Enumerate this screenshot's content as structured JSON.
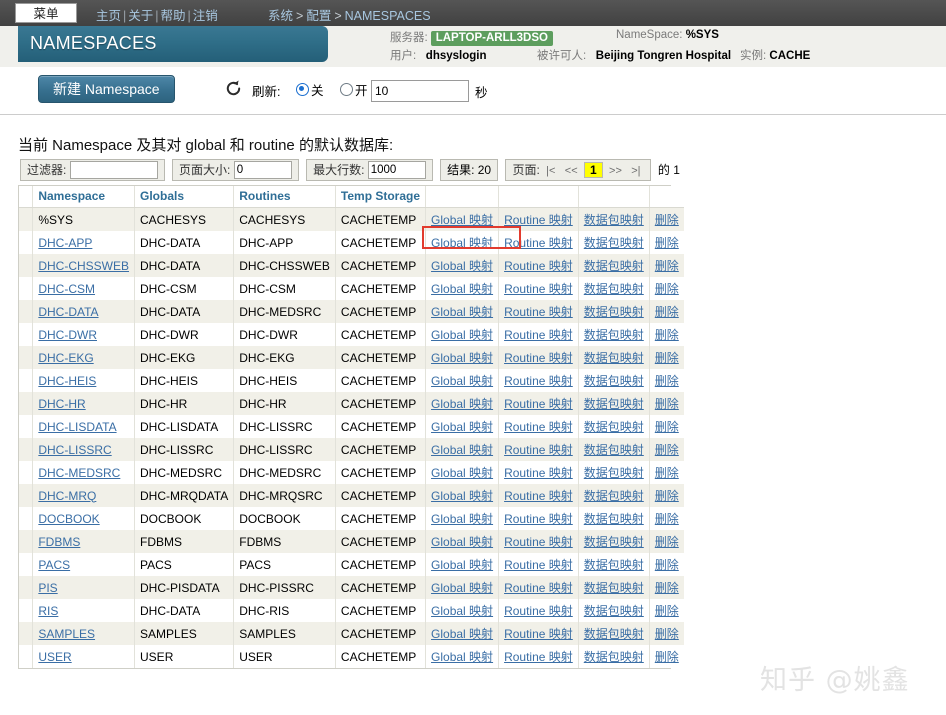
{
  "topbar": {
    "menu_label": "菜单",
    "nav_links": [
      "主页",
      "关于",
      "帮助",
      "注销"
    ],
    "breadcrumb": [
      "系统",
      "配置",
      "NAMESPACES"
    ],
    "breadcrumb_arrow": ">"
  },
  "header": {
    "page_title": "NAMESPACES",
    "server_label": "服务器:",
    "server_value": "LAPTOP-ARLL3DSO",
    "namespace_label": "NameSpace:",
    "namespace_value": "%SYS",
    "user_label": "用户:",
    "user_value": "dhsyslogin",
    "licensee_label": "被许可人:",
    "licensee_value": "Beijing Tongren Hospital",
    "instance_label": "实例:",
    "instance_value": "CACHE"
  },
  "toolbar": {
    "new_namespace_label": "新建 Namespace",
    "refresh_icon": "refresh-circular-arrow-icon",
    "refresh_label": "刷新:",
    "radio_off_label": "关",
    "radio_on_label": "开",
    "radio_selected": "关",
    "seconds_value": "10",
    "seconds_placeholder": "",
    "seconds_label": "秒"
  },
  "content": {
    "heading": "当前 Namespace 及其对 global 和 routine 的默认数据库:"
  },
  "filterbar": {
    "filter_label": "过滤器:",
    "filter_value": "",
    "filter_placeholder": "",
    "page_size_label": "页面大小:",
    "page_size_value": "0",
    "max_rows_label": "最大行数:",
    "max_rows_value": "1000",
    "results_label": "结果: 20",
    "page_label": "页面:",
    "first_icon": "|<",
    "prev_icon": "<<",
    "current_page": "1",
    "next_icon": ">>",
    "last_icon": ">|",
    "of_label": "的",
    "total_pages": "1"
  },
  "table": {
    "columns": [
      "",
      "Namespace",
      "Globals",
      "Routines",
      "Temp Storage",
      "",
      "",
      "",
      ""
    ],
    "actions": {
      "global_mapping": "Global 映射",
      "routine_mapping": "Routine 映射",
      "package_mapping": "数据包映射",
      "delete": "删除"
    },
    "rows": [
      {
        "namespace": "%SYS",
        "is_link": false,
        "globals": "CACHESYS",
        "routines": "CACHESYS",
        "temp": "CACHETEMP"
      },
      {
        "namespace": "DHC-APP",
        "is_link": true,
        "globals": "DHC-DATA",
        "routines": "DHC-APP",
        "temp": "CACHETEMP"
      },
      {
        "namespace": "DHC-CHSSWEB",
        "is_link": true,
        "globals": "DHC-DATA",
        "routines": "DHC-CHSSWEB",
        "temp": "CACHETEMP"
      },
      {
        "namespace": "DHC-CSM",
        "is_link": true,
        "globals": "DHC-CSM",
        "routines": "DHC-CSM",
        "temp": "CACHETEMP"
      },
      {
        "namespace": "DHC-DATA",
        "is_link": true,
        "globals": "DHC-DATA",
        "routines": "DHC-MEDSRC",
        "temp": "CACHETEMP"
      },
      {
        "namespace": "DHC-DWR",
        "is_link": true,
        "globals": "DHC-DWR",
        "routines": "DHC-DWR",
        "temp": "CACHETEMP"
      },
      {
        "namespace": "DHC-EKG",
        "is_link": true,
        "globals": "DHC-EKG",
        "routines": "DHC-EKG",
        "temp": "CACHETEMP"
      },
      {
        "namespace": "DHC-HEIS",
        "is_link": true,
        "globals": "DHC-HEIS",
        "routines": "DHC-HEIS",
        "temp": "CACHETEMP"
      },
      {
        "namespace": "DHC-HR",
        "is_link": true,
        "globals": "DHC-HR",
        "routines": "DHC-HR",
        "temp": "CACHETEMP"
      },
      {
        "namespace": "DHC-LISDATA",
        "is_link": true,
        "globals": "DHC-LISDATA",
        "routines": "DHC-LISSRC",
        "temp": "CACHETEMP"
      },
      {
        "namespace": "DHC-LISSRC",
        "is_link": true,
        "globals": "DHC-LISSRC",
        "routines": "DHC-LISSRC",
        "temp": "CACHETEMP"
      },
      {
        "namespace": "DHC-MEDSRC",
        "is_link": true,
        "globals": "DHC-MEDSRC",
        "routines": "DHC-MEDSRC",
        "temp": "CACHETEMP"
      },
      {
        "namespace": "DHC-MRQ",
        "is_link": true,
        "globals": "DHC-MRQDATA",
        "routines": "DHC-MRQSRC",
        "temp": "CACHETEMP"
      },
      {
        "namespace": "DOCBOOK",
        "is_link": true,
        "globals": "DOCBOOK",
        "routines": "DOCBOOK",
        "temp": "CACHETEMP"
      },
      {
        "namespace": "FDBMS",
        "is_link": true,
        "globals": "FDBMS",
        "routines": "FDBMS",
        "temp": "CACHETEMP"
      },
      {
        "namespace": "PACS",
        "is_link": true,
        "globals": "PACS",
        "routines": "PACS",
        "temp": "CACHETEMP"
      },
      {
        "namespace": "PIS",
        "is_link": true,
        "globals": "DHC-PISDATA",
        "routines": "DHC-PISSRC",
        "temp": "CACHETEMP"
      },
      {
        "namespace": "RIS",
        "is_link": true,
        "globals": "DHC-DATA",
        "routines": "DHC-RIS",
        "temp": "CACHETEMP"
      },
      {
        "namespace": "SAMPLES",
        "is_link": true,
        "globals": "SAMPLES",
        "routines": "SAMPLES",
        "temp": "CACHETEMP"
      },
      {
        "namespace": "USER",
        "is_link": true,
        "globals": "USER",
        "routines": "USER",
        "temp": "CACHETEMP"
      }
    ]
  },
  "annotation": {
    "highlight_color": "#e23b2e",
    "target": "Global 映射"
  },
  "watermark": {
    "text": "知乎 @姚鑫"
  }
}
